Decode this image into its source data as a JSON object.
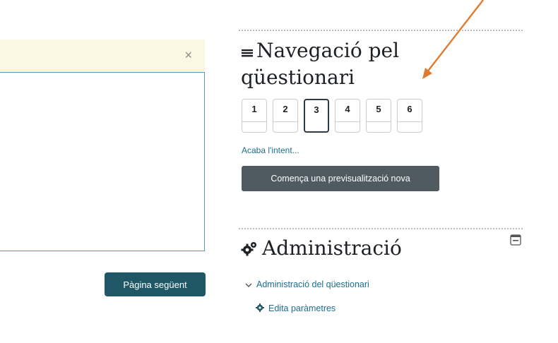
{
  "notice": {
    "close_glyph": "×"
  },
  "left": {
    "next_page_label": "Pàgina següent"
  },
  "quiz_nav": {
    "title": "Navegació pel qüestionari",
    "title_icon": "hamburger-icon",
    "questions": [
      {
        "number": "1",
        "current": false
      },
      {
        "number": "2",
        "current": false
      },
      {
        "number": "3",
        "current": true
      },
      {
        "number": "4",
        "current": false
      },
      {
        "number": "5",
        "current": false
      },
      {
        "number": "6",
        "current": false
      }
    ],
    "finish_attempt": "Acaba l'intent...",
    "new_preview": "Comença una previsualització nova"
  },
  "administration": {
    "title": "Administració",
    "title_icon": "cogs-icon",
    "collapse_icon": "minus-square-icon",
    "quiz_admin": "Administració del qüestionari",
    "edit_settings": "Edita paràmetres",
    "edit_settings_icon": "gear-icon"
  },
  "colors": {
    "accent_arrow": "#e07b2e",
    "primary_button": "#1f5766",
    "secondary_button": "#4f5a61",
    "link": "#1f6d8e",
    "notice_bg": "#fcf7e3"
  }
}
